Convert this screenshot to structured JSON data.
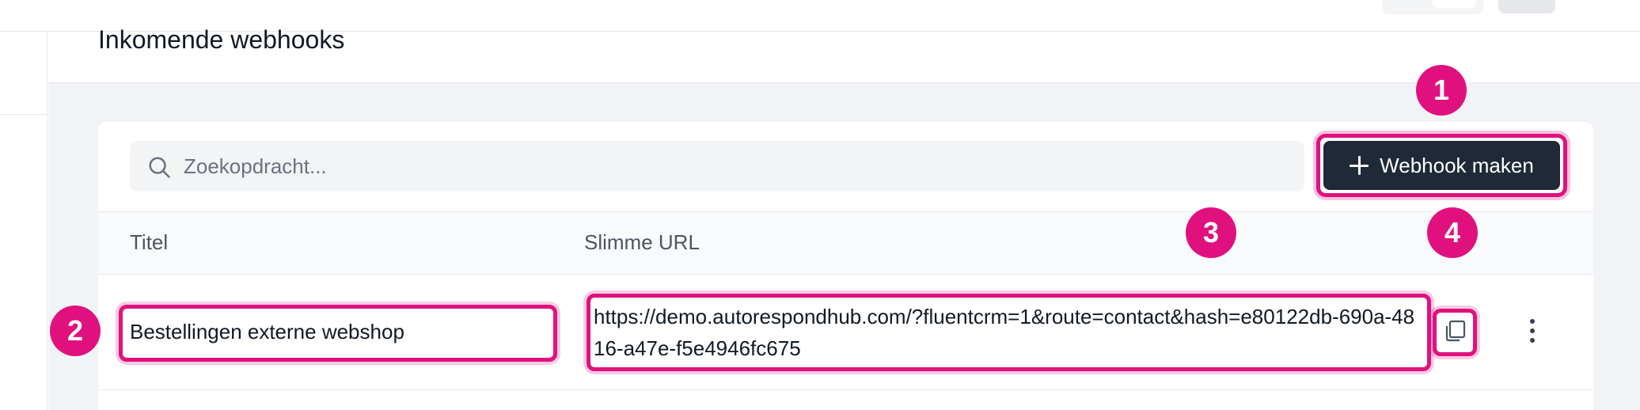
{
  "page": {
    "title": "Inkomende webhooks"
  },
  "search": {
    "placeholder": "Zoekopdracht..."
  },
  "toolbar": {
    "make_label": "Webhook maken"
  },
  "table": {
    "columns": [
      "Titel",
      "Slimme URL"
    ],
    "rows": [
      {
        "title": "Bestellingen externe webshop",
        "url": "https://demo.autorespondhub.com/?fluentcrm=1&route=contact&hash=e80122db-690a-4816-a47e-f5e4946fc675"
      }
    ]
  },
  "annotations": {
    "badges": [
      "1",
      "2",
      "3",
      "4"
    ]
  },
  "colors": {
    "highlight": "#e0117f",
    "button_bg": "#1f2937",
    "page_bg": "#f1f3f6"
  },
  "icons": {
    "search": "search-icon",
    "plus": "plus-icon",
    "copy": "copy-icon",
    "more": "more-vertical-icon"
  }
}
